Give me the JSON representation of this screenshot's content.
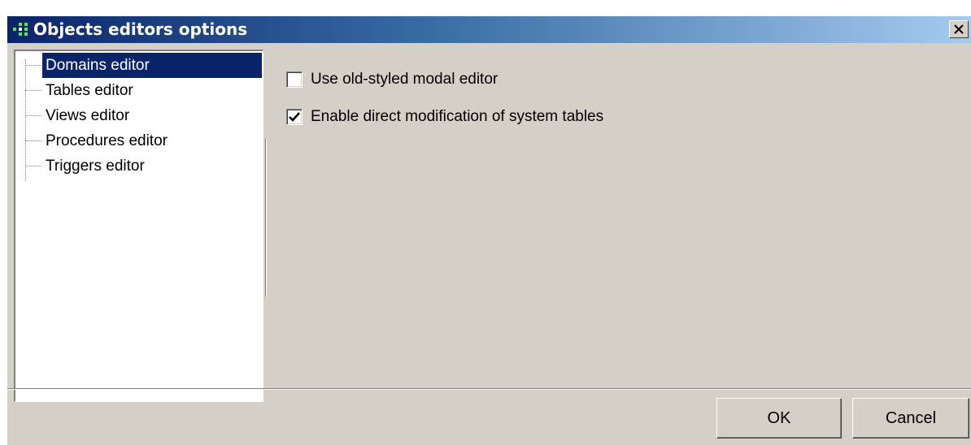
{
  "window": {
    "title": "Objects editors options"
  },
  "tree": {
    "items": [
      {
        "label": "Domains editor",
        "selected": true
      },
      {
        "label": "Tables editor",
        "selected": false
      },
      {
        "label": "Views editor",
        "selected": false
      },
      {
        "label": "Procedures editor",
        "selected": false
      },
      {
        "label": "Triggers editor",
        "selected": false
      }
    ]
  },
  "options": [
    {
      "label": "Use old-styled modal editor",
      "checked": false
    },
    {
      "label": "Enable direct modification of system tables",
      "checked": true
    }
  ],
  "buttons": {
    "ok": "OK",
    "cancel": "Cancel"
  },
  "colors": {
    "title_start": "#0a246a",
    "title_end": "#a6caf0",
    "selection": "#0a246a",
    "face": "#d4d0c8"
  },
  "icons": {
    "app": "app-icon",
    "close": "close-icon",
    "check": "check-icon"
  }
}
